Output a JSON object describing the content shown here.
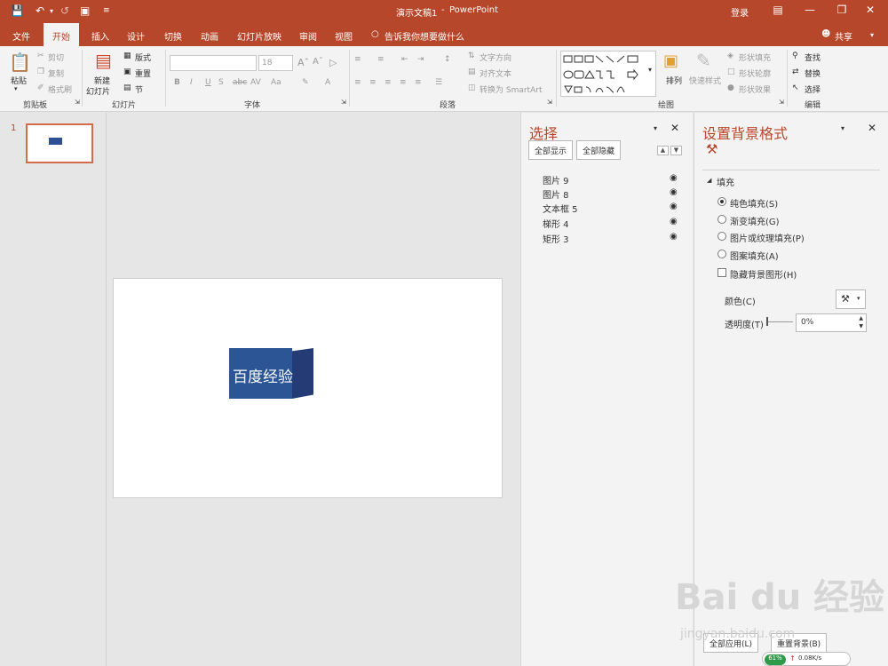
{
  "titlebar": {
    "doc_title": "演示文稿1",
    "app_sep": "-",
    "app_name": "PowerPoint",
    "login": "登录"
  },
  "tabs": [
    "文件",
    "开始",
    "插入",
    "设计",
    "切换",
    "动画",
    "幻灯片放映",
    "审阅",
    "视图"
  ],
  "tell_me": "告诉我你想要做什么",
  "share": "共享",
  "ribbon": {
    "clipboard": {
      "paste": "粘贴",
      "cut": "剪切",
      "copy": "复制",
      "format_painter": "格式刷",
      "label": "剪贴板"
    },
    "slides": {
      "new_slide_1": "新建",
      "new_slide_2": "幻灯片",
      "layout": "版式",
      "reset": "重置",
      "section": "节",
      "label": "幻灯片"
    },
    "font": {
      "size": "18",
      "label": "字体"
    },
    "paragraph": {
      "text_direction": "文字方向",
      "align_text": "对齐文本",
      "smartart": "转换为 SmartArt",
      "label": "段落"
    },
    "drawing": {
      "arrange": "排列",
      "quick_styles": "快速样式",
      "shape_fill": "形状填充",
      "shape_outline": "形状轮廓",
      "shape_effects": "形状效果",
      "label": "绘图"
    },
    "editing": {
      "find": "查找",
      "replace": "替换",
      "select": "选择",
      "label": "编辑"
    }
  },
  "thumbnails": {
    "slide_number": "1"
  },
  "slide": {
    "box_text": "百度经验"
  },
  "selection_pane": {
    "title": "选择",
    "show_all": "全部显示",
    "hide_all": "全部隐藏",
    "items": [
      "图片 9",
      "图片 8",
      "文本框 5",
      "梯形 4",
      "矩形 3"
    ]
  },
  "format_pane": {
    "title": "设置背景格式",
    "section": "填充",
    "options": [
      "纯色填充(S)",
      "渐变填充(G)",
      "图片或纹理填充(P)",
      "图案填充(A)"
    ],
    "hide_bg": "隐藏背景图形(H)",
    "color_label": "颜色(C)",
    "transparency_label": "透明度(T)",
    "transparency_value": "0%",
    "apply_all": "全部应用(L)",
    "reset_bg": "重置背景(B)"
  },
  "watermark": {
    "brand": "Bai du 经验",
    "url": "jingyan.baidu.com",
    "net_percent": "61%",
    "net_speed": "0.08K/s"
  },
  "colors": {
    "accent": "#b7472a",
    "box_front": "#2c5596",
    "box_side": "#243b75"
  }
}
